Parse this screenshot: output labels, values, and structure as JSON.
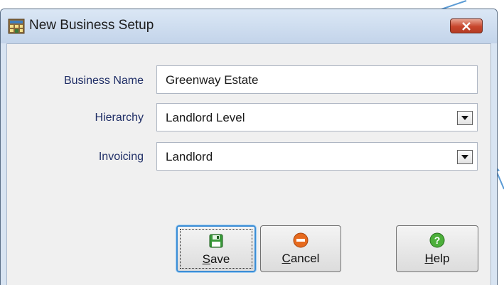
{
  "window": {
    "title": "New Business Setup"
  },
  "form": {
    "business_name": {
      "label": "Business Name",
      "value": "Greenway Estate"
    },
    "hierarchy": {
      "label": "Hierarchy",
      "value": "Landlord Level"
    },
    "invoicing": {
      "label": "Invoicing",
      "value": "Landlord"
    }
  },
  "buttons": {
    "save": {
      "mnemonic": "S",
      "rest": "ave"
    },
    "cancel": {
      "mnemonic": "C",
      "rest": "ancel"
    },
    "help": {
      "mnemonic": "H",
      "rest": "elp"
    }
  },
  "colors": {
    "label_text": "#1f2e66",
    "annotation_arrow": "#5b9bd5",
    "close_button": "#c7452c",
    "default_button_border": "#3c8ed6"
  },
  "icons": {
    "title": "app-window-icon",
    "close": "close-icon",
    "save": "floppy-disk-icon",
    "cancel": "no-entry-icon",
    "help": "question-mark-icon",
    "dropdown": "chevron-down-icon"
  }
}
